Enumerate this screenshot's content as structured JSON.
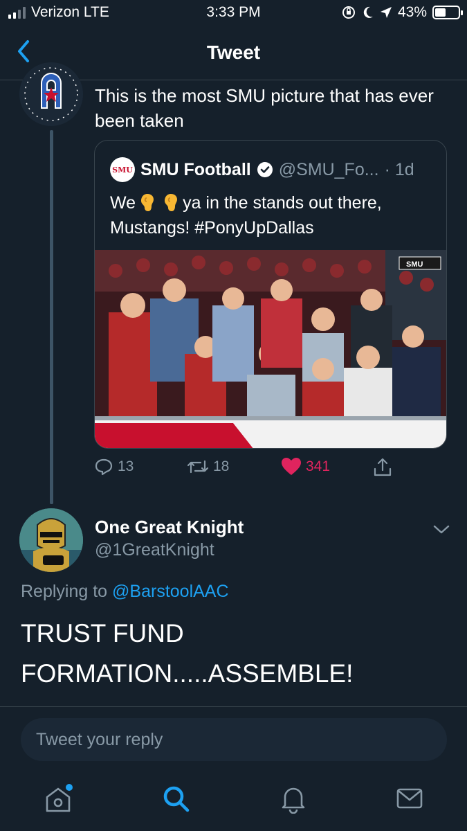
{
  "status_bar": {
    "carrier": "Verizon LTE",
    "time": "3:33 PM",
    "battery": "43%",
    "battery_level": 0.43
  },
  "nav": {
    "title": "Tweet",
    "back_icon": "chevron-left-icon"
  },
  "original_tweet": {
    "text": "This is the most SMU picture that has ever been taken",
    "quoted": {
      "name": "SMU Football",
      "handle": "@SMU_Fo...",
      "time": "· 1d",
      "text_before": "We",
      "text_after": "ya in the stands out there, Mustangs! #PonyUpDallas",
      "emoji": [
        "ear-emoji",
        "ear-emoji"
      ],
      "photo_banner": "SMU"
    },
    "actions": {
      "replies": "13",
      "retweets": "18",
      "likes": "341",
      "like_color": "#e0245e"
    }
  },
  "reply": {
    "name": "One Great Knight",
    "handle": "@1GreatKnight",
    "replying_prefix": "Replying to",
    "replying_to": "@BarstoolAAC",
    "text": "TRUST FUND FORMATION.....ASSEMBLE!"
  },
  "composer": {
    "placeholder": "Tweet your reply"
  },
  "tabs": [
    "home-icon",
    "search-icon",
    "notifications-icon",
    "messages-icon"
  ],
  "colors": {
    "background": "#15202b",
    "accent": "#1da1f2",
    "muted": "#8899a6",
    "border": "#38444d"
  }
}
